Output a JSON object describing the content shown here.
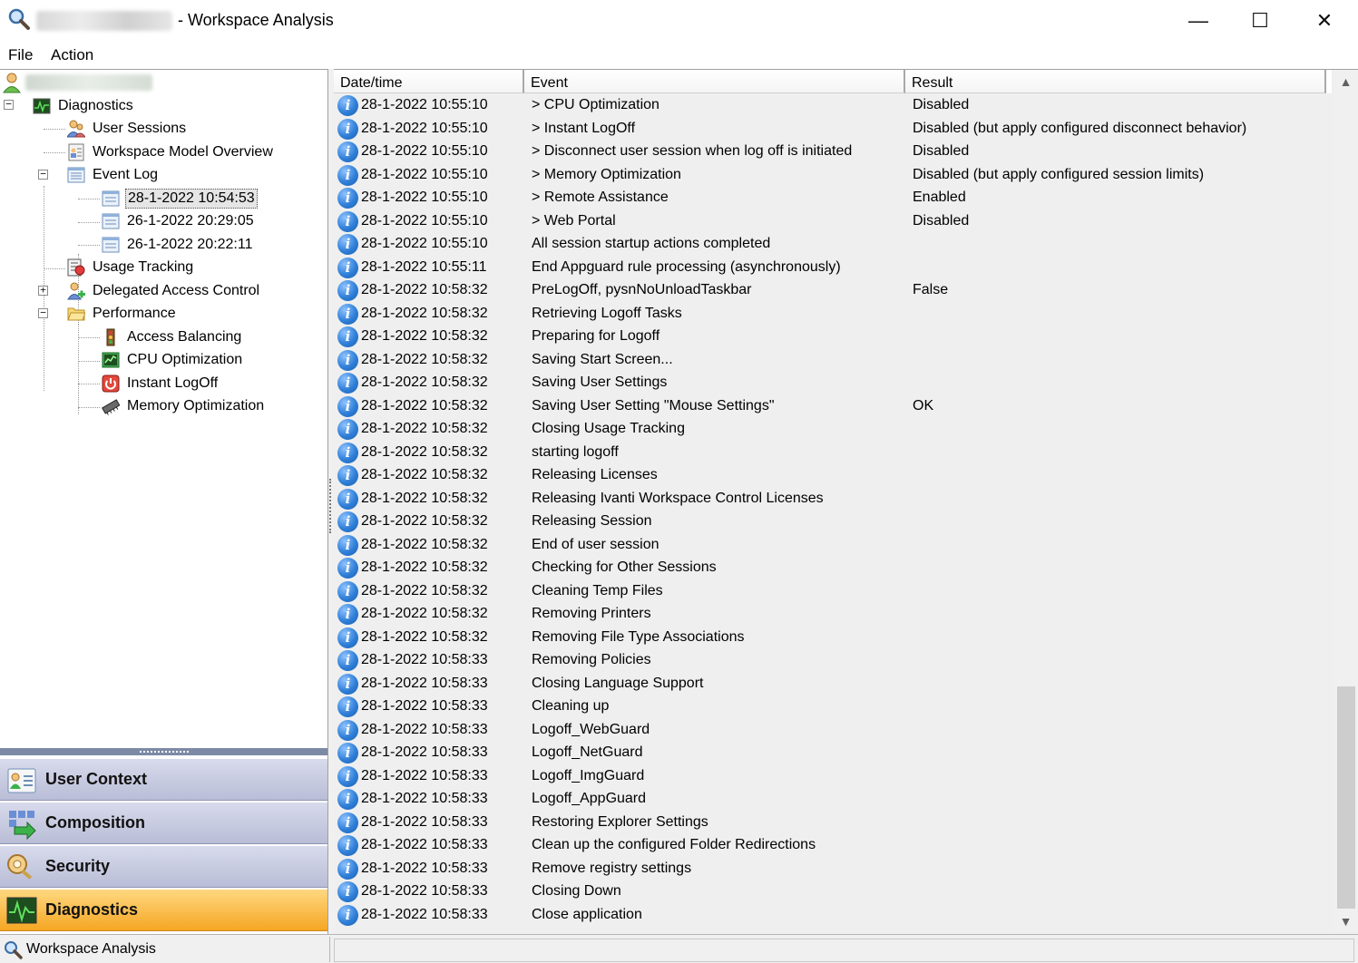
{
  "window": {
    "title_suffix": "- Workspace Analysis",
    "minimize": "—",
    "maximize": "☐",
    "close": "✕"
  },
  "menu": {
    "file": "File",
    "action": "Action"
  },
  "tree": {
    "diagnostics": "Diagnostics",
    "user_sessions": "User Sessions",
    "workspace_model_overview": "Workspace Model Overview",
    "event_log": "Event Log",
    "log1": "28-1-2022 10:54:53",
    "log2": "26-1-2022 20:29:05",
    "log3": "26-1-2022 20:22:11",
    "usage_tracking": "Usage Tracking",
    "delegated_access_control": "Delegated Access Control",
    "performance": "Performance",
    "access_balancing": "Access Balancing",
    "cpu_optimization": "CPU Optimization",
    "instant_logoff": "Instant LogOff",
    "memory_optimization": "Memory Optimization",
    "expand_minus": "−",
    "expand_plus": "+"
  },
  "nav": {
    "user_context": "User Context",
    "composition": "Composition",
    "security": "Security",
    "diagnostics": "Diagnostics"
  },
  "grid": {
    "headers": {
      "datetime": "Date/time",
      "event": "Event",
      "result": "Result"
    },
    "rows": [
      {
        "date": "28-1-2022 10:55:10",
        "event": "> CPU Optimization",
        "result": "Disabled"
      },
      {
        "date": "28-1-2022 10:55:10",
        "event": "> Instant LogOff",
        "result": "Disabled (but apply configured disconnect behavior)"
      },
      {
        "date": "28-1-2022 10:55:10",
        "event": "> Disconnect user session when log off is initiated",
        "result": "Disabled"
      },
      {
        "date": "28-1-2022 10:55:10",
        "event": "> Memory Optimization",
        "result": "Disabled (but apply configured session limits)"
      },
      {
        "date": "28-1-2022 10:55:10",
        "event": "> Remote Assistance",
        "result": "Enabled"
      },
      {
        "date": "28-1-2022 10:55:10",
        "event": "> Web Portal",
        "result": "Disabled"
      },
      {
        "date": "28-1-2022 10:55:10",
        "event": "All session startup actions completed",
        "result": ""
      },
      {
        "date": "28-1-2022 10:55:11",
        "event": "End Appguard rule processing (asynchronously)",
        "result": ""
      },
      {
        "date": "28-1-2022 10:58:32",
        "event": "PreLogOff, pysnNoUnloadTaskbar",
        "result": "False"
      },
      {
        "date": "28-1-2022 10:58:32",
        "event": "Retrieving Logoff Tasks",
        "result": ""
      },
      {
        "date": "28-1-2022 10:58:32",
        "event": "Preparing for Logoff",
        "result": ""
      },
      {
        "date": "28-1-2022 10:58:32",
        "event": "Saving Start Screen...",
        "result": ""
      },
      {
        "date": "28-1-2022 10:58:32",
        "event": "Saving User Settings",
        "result": ""
      },
      {
        "date": "28-1-2022 10:58:32",
        "event": "Saving User Setting \"Mouse Settings\"",
        "result": "OK"
      },
      {
        "date": "28-1-2022 10:58:32",
        "event": "Closing Usage Tracking",
        "result": ""
      },
      {
        "date": "28-1-2022 10:58:32",
        "event": "starting logoff",
        "result": ""
      },
      {
        "date": "28-1-2022 10:58:32",
        "event": "Releasing Licenses",
        "result": ""
      },
      {
        "date": "28-1-2022 10:58:32",
        "event": "Releasing Ivanti Workspace Control Licenses",
        "result": ""
      },
      {
        "date": "28-1-2022 10:58:32",
        "event": "Releasing Session",
        "result": ""
      },
      {
        "date": "28-1-2022 10:58:32",
        "event": "End of user session",
        "result": ""
      },
      {
        "date": "28-1-2022 10:58:32",
        "event": "Checking for Other Sessions",
        "result": ""
      },
      {
        "date": "28-1-2022 10:58:32",
        "event": "Cleaning Temp Files",
        "result": ""
      },
      {
        "date": "28-1-2022 10:58:32",
        "event": "Removing Printers",
        "result": ""
      },
      {
        "date": "28-1-2022 10:58:32",
        "event": "Removing File Type Associations",
        "result": ""
      },
      {
        "date": "28-1-2022 10:58:33",
        "event": "Removing Policies",
        "result": ""
      },
      {
        "date": "28-1-2022 10:58:33",
        "event": "Closing Language Support",
        "result": ""
      },
      {
        "date": "28-1-2022 10:58:33",
        "event": "Cleaning up",
        "result": ""
      },
      {
        "date": "28-1-2022 10:58:33",
        "event": "Logoff_WebGuard",
        "result": ""
      },
      {
        "date": "28-1-2022 10:58:33",
        "event": "Logoff_NetGuard",
        "result": ""
      },
      {
        "date": "28-1-2022 10:58:33",
        "event": "Logoff_ImgGuard",
        "result": ""
      },
      {
        "date": "28-1-2022 10:58:33",
        "event": "Logoff_AppGuard",
        "result": ""
      },
      {
        "date": "28-1-2022 10:58:33",
        "event": "Restoring Explorer Settings",
        "result": ""
      },
      {
        "date": "28-1-2022 10:58:33",
        "event": "Clean up the configured Folder Redirections",
        "result": ""
      },
      {
        "date": "28-1-2022 10:58:33",
        "event": "Remove registry settings",
        "result": ""
      },
      {
        "date": "28-1-2022 10:58:33",
        "event": "Closing Down",
        "result": ""
      },
      {
        "date": "28-1-2022 10:58:33",
        "event": "Close application",
        "result": ""
      }
    ],
    "info_glyph": "i"
  },
  "scrollbar": {
    "up": "▲",
    "down": "▼"
  },
  "statusbar": {
    "text": "Workspace Analysis"
  },
  "colors": {
    "active_nav": "#f5a623",
    "nav": "#c4c7dd",
    "info": "#2f7fd8"
  }
}
